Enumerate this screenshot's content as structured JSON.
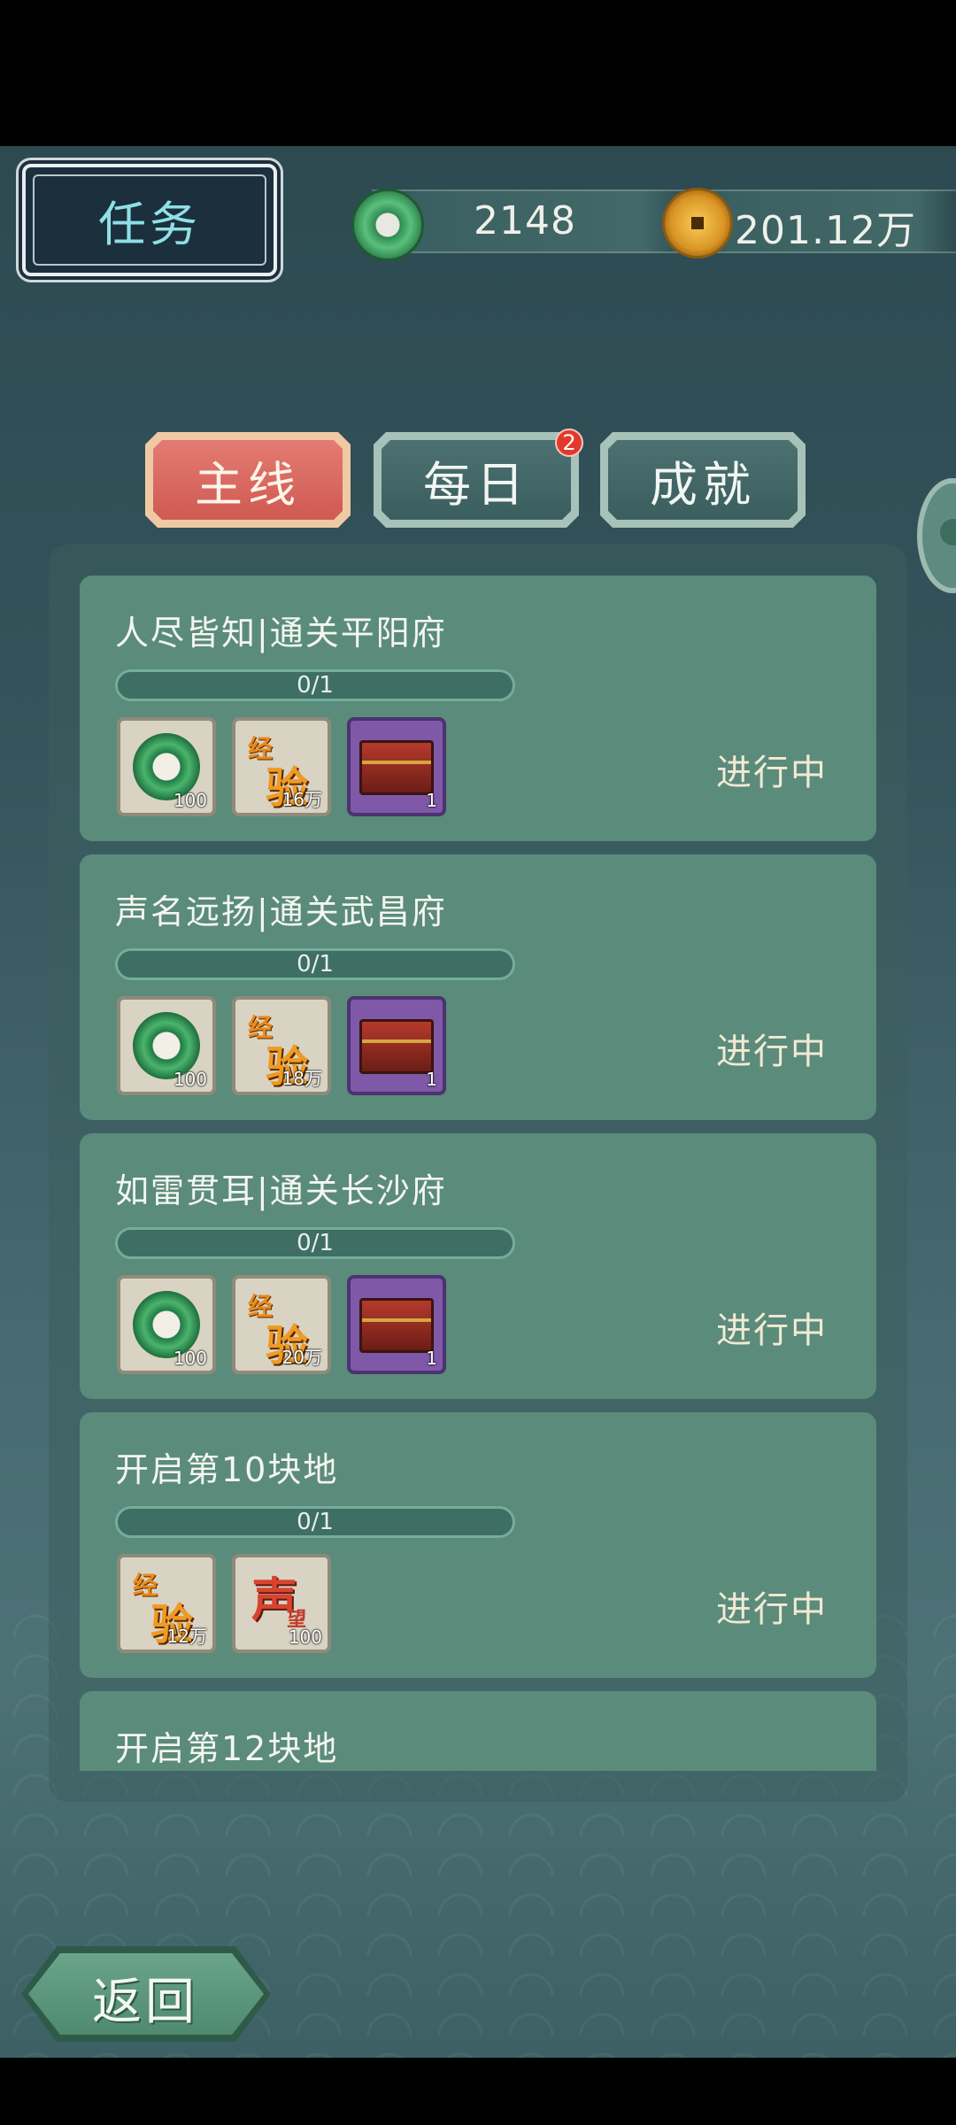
{
  "header": {
    "title": "任务",
    "jade_amount": "2148",
    "coin_amount": "201.12万"
  },
  "tabs": [
    {
      "label": "主线",
      "active": true
    },
    {
      "label": "每日",
      "active": false,
      "badge": "2"
    },
    {
      "label": "成就",
      "active": false
    }
  ],
  "quests": [
    {
      "title": "人尽皆知|通关平阳府",
      "progress": "0/1",
      "status": "进行中",
      "rewards": [
        {
          "icon": "jade-ring-icon",
          "qty": "100"
        },
        {
          "icon": "experience-icon",
          "qty": "16万"
        },
        {
          "icon": "treasure-chest-icon",
          "qty": "1"
        }
      ]
    },
    {
      "title": "声名远扬|通关武昌府",
      "progress": "0/1",
      "status": "进行中",
      "rewards": [
        {
          "icon": "jade-ring-icon",
          "qty": "100"
        },
        {
          "icon": "experience-icon",
          "qty": "18万"
        },
        {
          "icon": "treasure-chest-icon",
          "qty": "1"
        }
      ]
    },
    {
      "title": "如雷贯耳|通关长沙府",
      "progress": "0/1",
      "status": "进行中",
      "rewards": [
        {
          "icon": "jade-ring-icon",
          "qty": "100"
        },
        {
          "icon": "experience-icon",
          "qty": "20万"
        },
        {
          "icon": "treasure-chest-icon",
          "qty": "1"
        }
      ]
    },
    {
      "title": "开启第10块地",
      "progress": "0/1",
      "status": "进行中",
      "rewards": [
        {
          "icon": "experience-icon",
          "qty": "12万"
        },
        {
          "icon": "reputation-icon",
          "qty": "100"
        }
      ]
    },
    {
      "title": "开启第12块地"
    }
  ],
  "icon_glyphs": {
    "exp_small": "经",
    "exp_big": "验",
    "rep_big": "声",
    "rep_small": "望"
  },
  "footer": {
    "back_label": "返回"
  },
  "colors": {
    "card": "#5b8b7b",
    "active_tab": "#cf5a52",
    "inactive_tab": "#3b5e5f",
    "badge": "#e13a2c"
  }
}
